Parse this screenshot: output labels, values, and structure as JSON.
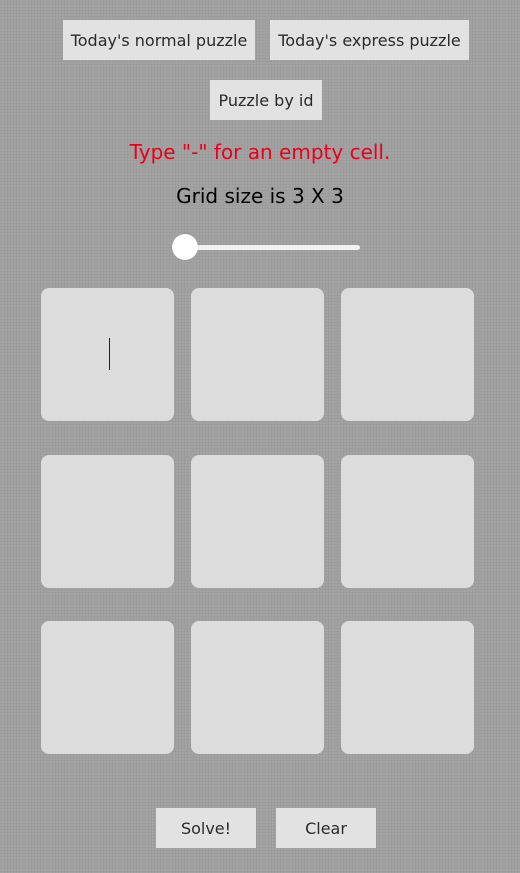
{
  "buttons": {
    "normal": "Today's normal puzzle",
    "express": "Today's express puzzle",
    "by_id": "Puzzle by id",
    "solve": "Solve!",
    "clear": "Clear"
  },
  "hint": "Type \"-\" for an empty cell.",
  "grid_size_text": "Grid size is 3 X 3",
  "grid": {
    "size": 3,
    "slider_value": 3,
    "cells": [
      "",
      "",
      "",
      "",
      "",
      "",
      "",
      "",
      ""
    ]
  },
  "colors": {
    "background": "#a3a3a3",
    "button": "#e2e2e2",
    "cell": "#dcdcdc",
    "hint": "#e8001c"
  }
}
